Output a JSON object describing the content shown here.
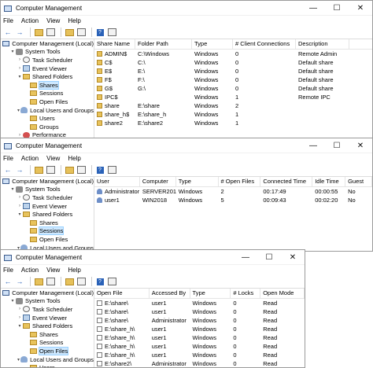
{
  "windows": [
    {
      "title": "Computer Management",
      "menu": [
        "File",
        "Action",
        "View",
        "Help"
      ],
      "tree": [
        {
          "label": "Computer Management (Local)",
          "icon": "computer-icon",
          "indent": 0,
          "expander": ""
        },
        {
          "label": "System Tools",
          "icon": "tools-icon",
          "indent": 1,
          "expander": "▾"
        },
        {
          "label": "Task Scheduler",
          "icon": "clock-icon",
          "indent": 2,
          "expander": "›"
        },
        {
          "label": "Event Viewer",
          "icon": "event-icon",
          "indent": 2,
          "expander": "›"
        },
        {
          "label": "Shared Folders",
          "icon": "folder-icon",
          "indent": 2,
          "expander": "▾"
        },
        {
          "label": "Shares",
          "icon": "folder-icon",
          "indent": 3,
          "expander": "",
          "selected": true
        },
        {
          "label": "Sessions",
          "icon": "folder-icon",
          "indent": 3,
          "expander": ""
        },
        {
          "label": "Open Files",
          "icon": "folder-icon",
          "indent": 3,
          "expander": ""
        },
        {
          "label": "Local Users and Groups",
          "icon": "users-icon",
          "indent": 2,
          "expander": "▾"
        },
        {
          "label": "Users",
          "icon": "folder-icon",
          "indent": 3,
          "expander": ""
        },
        {
          "label": "Groups",
          "icon": "folder-icon",
          "indent": 3,
          "expander": ""
        },
        {
          "label": "Performance",
          "icon": "perf-icon",
          "indent": 2,
          "expander": "›"
        }
      ],
      "row_icon": "share",
      "columns": [
        "Share Name",
        "Folder Path",
        "Type",
        "# Client Connections",
        "Description"
      ],
      "rows": [
        [
          "ADMIN$",
          "C:\\Windows",
          "Windows",
          "0",
          "Remote Admin"
        ],
        [
          "C$",
          "C:\\",
          "Windows",
          "0",
          "Default share"
        ],
        [
          "E$",
          "E:\\",
          "Windows",
          "0",
          "Default share"
        ],
        [
          "F$",
          "F:\\",
          "Windows",
          "0",
          "Default share"
        ],
        [
          "G$",
          "G:\\",
          "Windows",
          "0",
          "Default share"
        ],
        [
          "IPC$",
          "",
          "Windows",
          "1",
          "Remote IPC"
        ],
        [
          "share",
          "E:\\share",
          "Windows",
          "2",
          ""
        ],
        [
          "share_h$",
          "E:\\share_h",
          "Windows",
          "1",
          ""
        ],
        [
          "share2",
          "E:\\share2",
          "Windows",
          "1",
          ""
        ]
      ]
    },
    {
      "title": "Computer Management",
      "menu": [
        "File",
        "Action",
        "View",
        "Help"
      ],
      "tree": [
        {
          "label": "Computer Management (Local)",
          "icon": "computer-icon",
          "indent": 0,
          "expander": ""
        },
        {
          "label": "System Tools",
          "icon": "tools-icon",
          "indent": 1,
          "expander": "▾"
        },
        {
          "label": "Task Scheduler",
          "icon": "clock-icon",
          "indent": 2,
          "expander": "›"
        },
        {
          "label": "Event Viewer",
          "icon": "event-icon",
          "indent": 2,
          "expander": "›"
        },
        {
          "label": "Shared Folders",
          "icon": "folder-icon",
          "indent": 2,
          "expander": "▾"
        },
        {
          "label": "Shares",
          "icon": "folder-icon",
          "indent": 3,
          "expander": ""
        },
        {
          "label": "Sessions",
          "icon": "folder-icon",
          "indent": 3,
          "expander": "",
          "selected": true
        },
        {
          "label": "Open Files",
          "icon": "folder-icon",
          "indent": 3,
          "expander": ""
        },
        {
          "label": "Local Users and Groups",
          "icon": "users-icon",
          "indent": 2,
          "expander": "▾"
        }
      ],
      "row_icon": "sess",
      "columns": [
        "User",
        "Computer",
        "Type",
        "# Open Files",
        "Connected Time",
        "Idle Time",
        "Guest"
      ],
      "rows": [
        [
          "Administrator",
          "SERVER201...",
          "Windows",
          "2",
          "00:17:49",
          "00:00:55",
          "No"
        ],
        [
          "user1",
          "WIN2018",
          "Windows",
          "5",
          "00:09:43",
          "00:02:20",
          "No"
        ]
      ]
    },
    {
      "title": "Computer Management",
      "menu": [
        "File",
        "Action",
        "View",
        "Help"
      ],
      "tree": [
        {
          "label": "Computer Management (Local)",
          "icon": "computer-icon",
          "indent": 0,
          "expander": ""
        },
        {
          "label": "System Tools",
          "icon": "tools-icon",
          "indent": 1,
          "expander": "▾"
        },
        {
          "label": "Task Scheduler",
          "icon": "clock-icon",
          "indent": 2,
          "expander": "›"
        },
        {
          "label": "Event Viewer",
          "icon": "event-icon",
          "indent": 2,
          "expander": "›"
        },
        {
          "label": "Shared Folders",
          "icon": "folder-icon",
          "indent": 2,
          "expander": "▾"
        },
        {
          "label": "Shares",
          "icon": "folder-icon",
          "indent": 3,
          "expander": ""
        },
        {
          "label": "Sessions",
          "icon": "folder-icon",
          "indent": 3,
          "expander": ""
        },
        {
          "label": "Open Files",
          "icon": "folder-icon",
          "indent": 3,
          "expander": "",
          "selected": true
        },
        {
          "label": "Local Users and Groups",
          "icon": "users-icon",
          "indent": 2,
          "expander": "▾"
        },
        {
          "label": "Users",
          "icon": "folder-icon",
          "indent": 3,
          "expander": ""
        }
      ],
      "row_icon": "file",
      "columns": [
        "Open File",
        "Accessed By",
        "Type",
        "# Locks",
        "Open Mode"
      ],
      "rows": [
        [
          "E:\\share\\",
          "user1",
          "Windows",
          "0",
          "Read"
        ],
        [
          "E:\\share\\",
          "user1",
          "Windows",
          "0",
          "Read"
        ],
        [
          "E:\\share\\",
          "Administrator",
          "Windows",
          "0",
          "Read"
        ],
        [
          "E:\\share_h\\",
          "user1",
          "Windows",
          "0",
          "Read"
        ],
        [
          "E:\\share_h\\",
          "user1",
          "Windows",
          "0",
          "Read"
        ],
        [
          "E:\\share_h\\",
          "user1",
          "Windows",
          "0",
          "Read"
        ],
        [
          "E:\\share_h\\",
          "user1",
          "Windows",
          "0",
          "Read"
        ],
        [
          "E:\\share2\\",
          "Administrator",
          "Windows",
          "0",
          "Read"
        ]
      ]
    }
  ],
  "window_controls": {
    "minimize": "—",
    "maximize": "☐",
    "close": "✕"
  },
  "toolbar_glyphs": {
    "back": "←",
    "forward": "→"
  }
}
